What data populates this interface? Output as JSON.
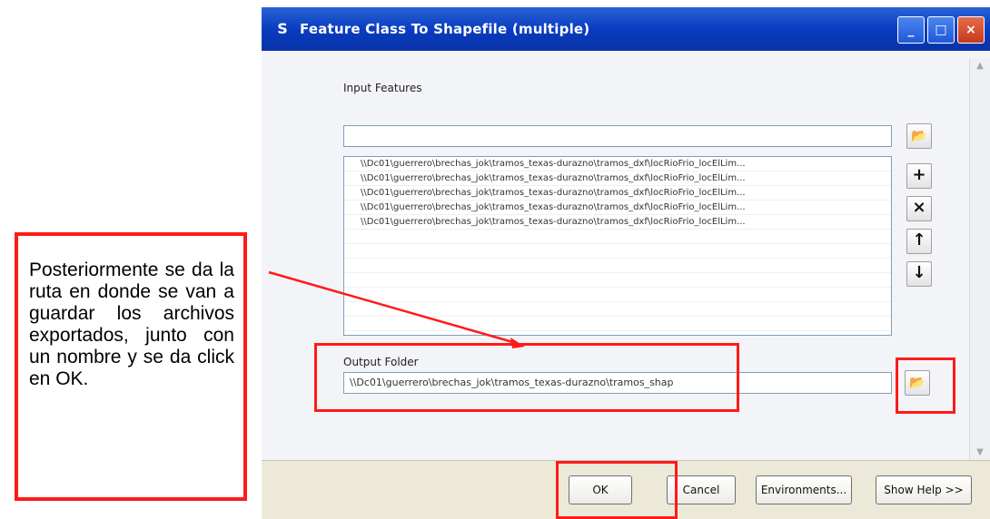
{
  "window": {
    "title": "Feature Class To Shapefile (multiple)",
    "title_icon": "S",
    "controls": {
      "minimize": "_",
      "maximize": "□",
      "close": "×"
    }
  },
  "input": {
    "label": "Input Features",
    "value": "",
    "list_items": [
      "\\\\Dc01\\guerrero\\brechas_jok\\tramos_texas-durazno\\tramos_dxf\\locRioFrio_locElLim...",
      "\\\\Dc01\\guerrero\\brechas_jok\\tramos_texas-durazno\\tramos_dxf\\locRioFrio_locElLim...",
      "\\\\Dc01\\guerrero\\brechas_jok\\tramos_texas-durazno\\tramos_dxf\\locRioFrio_locElLim...",
      "\\\\Dc01\\guerrero\\brechas_jok\\tramos_texas-durazno\\tramos_dxf\\locRioFrio_locElLim...",
      "\\\\Dc01\\guerrero\\brechas_jok\\tramos_texas-durazno\\tramos_dxf\\locRioFrio_locElLim..."
    ],
    "side_buttons": {
      "add": "+",
      "remove": "×",
      "up": "↑",
      "down": "↓"
    }
  },
  "output": {
    "label": "Output Folder",
    "value": "\\\\Dc01\\guerrero\\brechas_jok\\tramos_texas-durazno\\tramos_shap"
  },
  "buttons": {
    "ok": "OK",
    "cancel": "Cancel",
    "environments": "Environments...",
    "show_help": "Show Help >>"
  },
  "annotation": {
    "text": "Posteriormente se da la ruta en donde se van a guardar los archivos exportados, junto con un nombre y se da click en OK."
  },
  "colors": {
    "highlight": "#ff1a1a",
    "titlebar": "#0a3cc1"
  }
}
